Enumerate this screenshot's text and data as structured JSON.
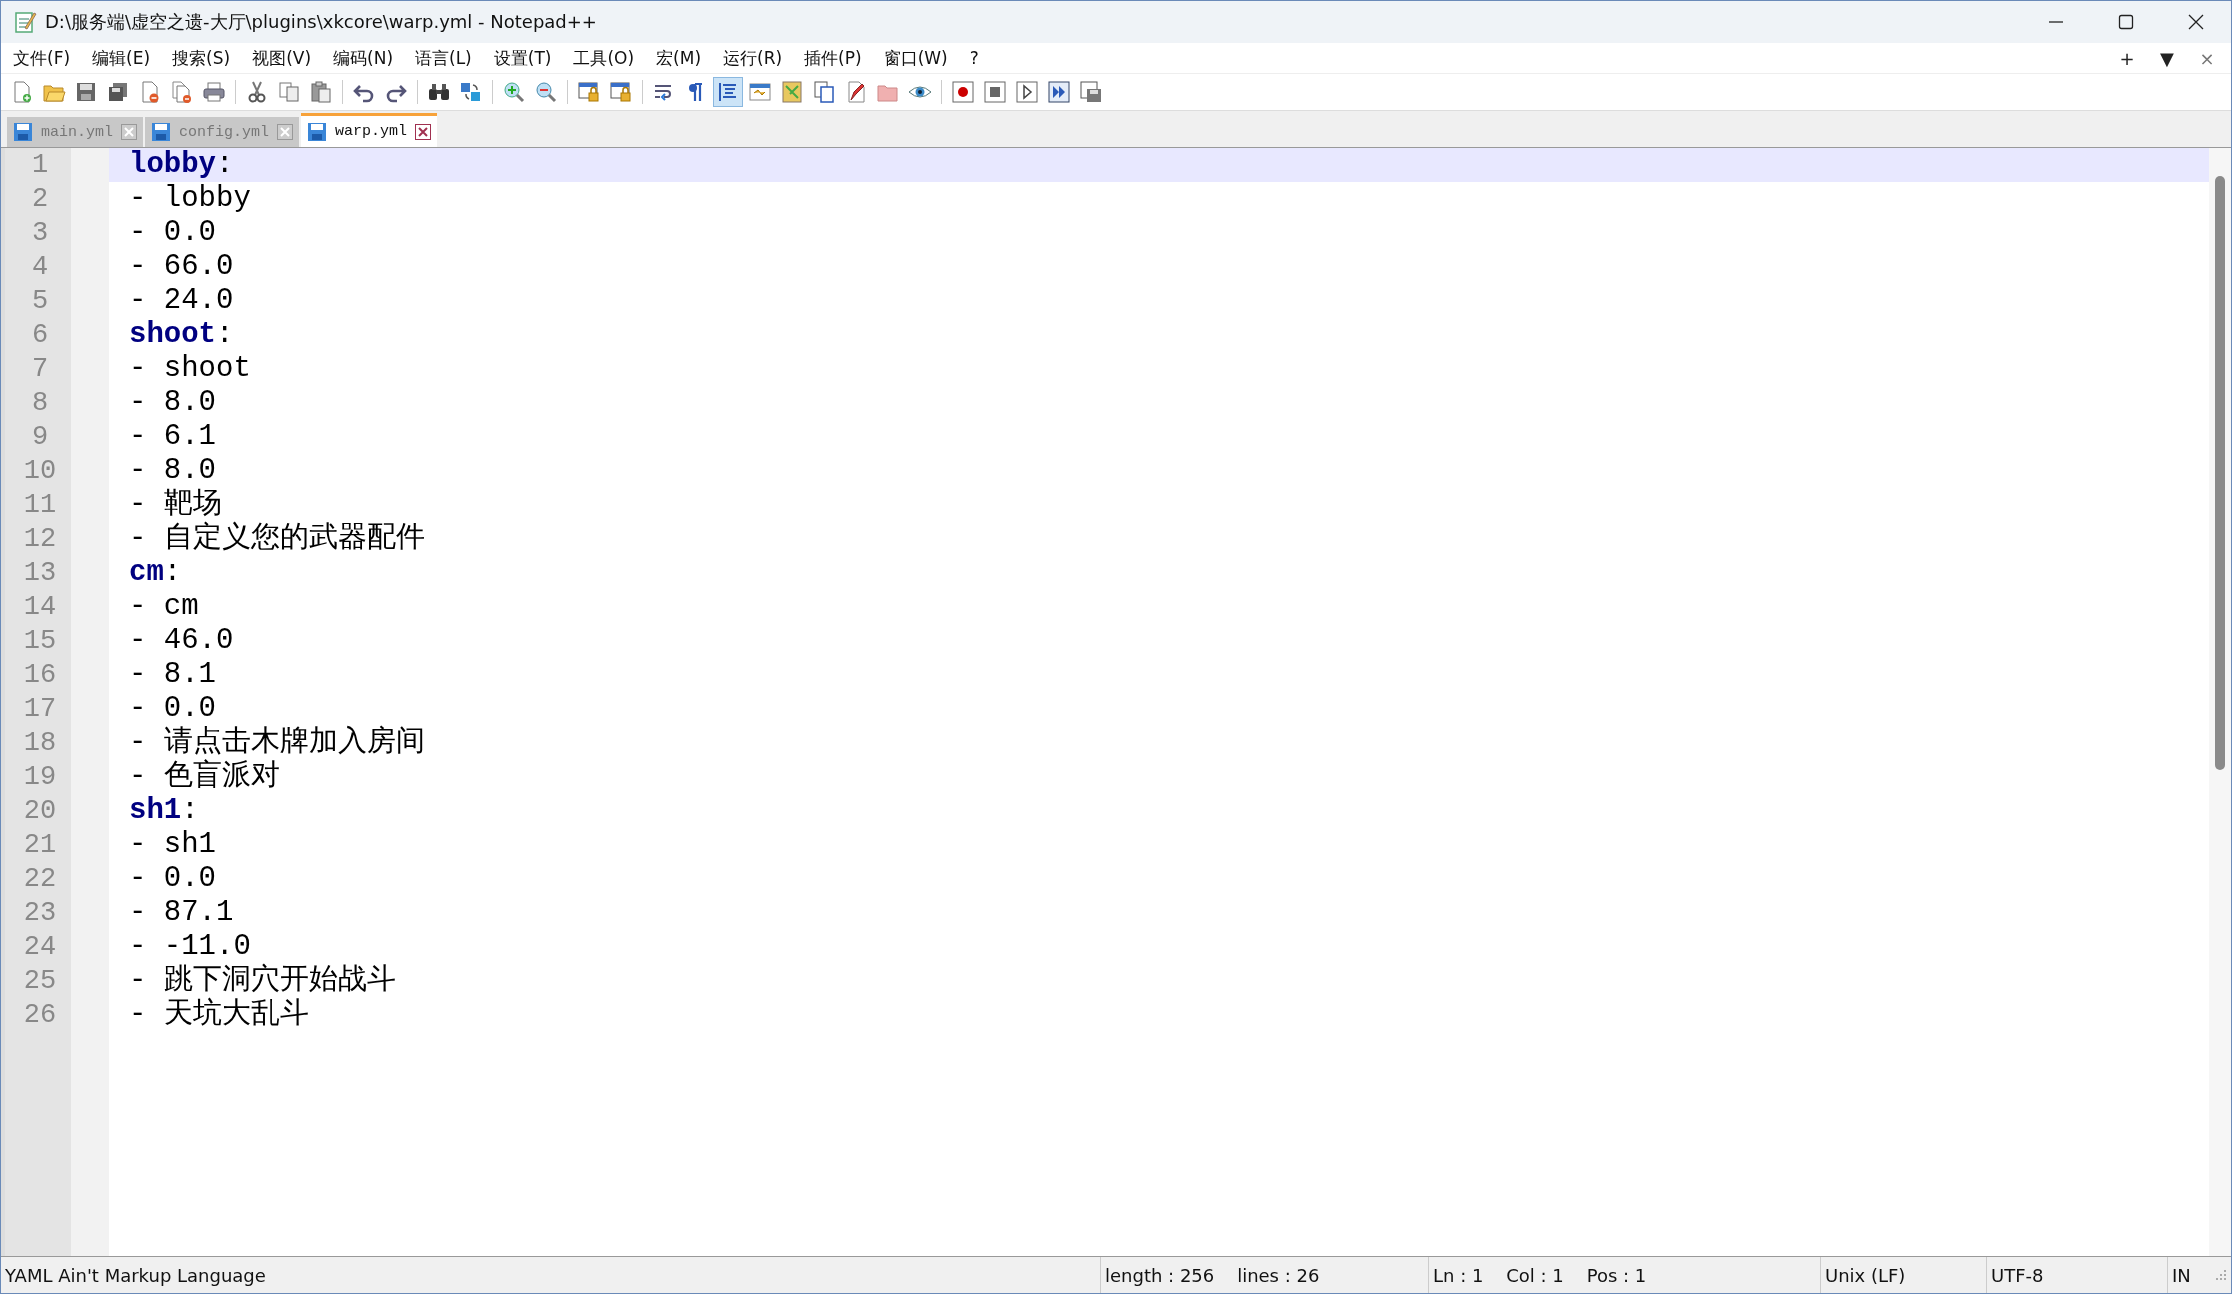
{
  "window": {
    "title": "D:\\服务端\\虚空之遗-大厅\\plugins\\xkcore\\warp.yml - Notepad++"
  },
  "menu": [
    "文件(F)",
    "编辑(E)",
    "搜索(S)",
    "视图(V)",
    "编码(N)",
    "语言(L)",
    "设置(T)",
    "工具(O)",
    "宏(M)",
    "运行(R)",
    "插件(P)",
    "窗口(W)",
    "?"
  ],
  "menu_right": [
    "+",
    "▼",
    "×"
  ],
  "toolbar": [
    [
      {
        "kind": "new",
        "pressed": false
      },
      {
        "kind": "open",
        "pressed": false
      },
      {
        "kind": "save",
        "pressed": false
      },
      {
        "kind": "saveall",
        "pressed": false
      },
      {
        "kind": "close",
        "pressed": false
      },
      {
        "kind": "closeall",
        "pressed": false
      },
      {
        "kind": "print",
        "pressed": false
      }
    ],
    [
      {
        "kind": "cut",
        "pressed": false
      },
      {
        "kind": "copy",
        "pressed": false
      },
      {
        "kind": "paste",
        "pressed": false
      }
    ],
    [
      {
        "kind": "undo",
        "pressed": false
      },
      {
        "kind": "redo",
        "pressed": false
      }
    ],
    [
      {
        "kind": "find",
        "pressed": false
      },
      {
        "kind": "replace",
        "pressed": false
      }
    ],
    [
      {
        "kind": "zoomin",
        "pressed": false
      },
      {
        "kind": "zoomout",
        "pressed": false
      }
    ],
    [
      {
        "kind": "lockwin",
        "pressed": false
      },
      {
        "kind": "lockwin",
        "pressed": false
      }
    ],
    [
      {
        "kind": "wrap",
        "pressed": false
      },
      {
        "kind": "pilcrow",
        "pressed": false
      },
      {
        "kind": "indent",
        "pressed": true
      },
      {
        "kind": "panel",
        "pressed": false
      },
      {
        "kind": "map",
        "pressed": false
      },
      {
        "kind": "pages",
        "pressed": false
      },
      {
        "kind": "pen",
        "pressed": false
      },
      {
        "kind": "folder",
        "pressed": false
      },
      {
        "kind": "eye",
        "pressed": false
      }
    ],
    [
      {
        "kind": "record",
        "pressed": false
      },
      {
        "kind": "stop",
        "pressed": false
      },
      {
        "kind": "play",
        "pressed": false
      },
      {
        "kind": "playmulti",
        "pressed": false
      },
      {
        "kind": "savemacro",
        "pressed": false
      }
    ]
  ],
  "tabs": [
    {
      "label": "main.yml",
      "selected": false
    },
    {
      "label": "config.yml",
      "selected": false
    },
    {
      "label": "warp.yml",
      "selected": true
    }
  ],
  "lines": [
    {
      "number": "1",
      "kind": "key",
      "key": "lobby",
      "sep": ":",
      "current": true
    },
    {
      "number": "2",
      "kind": "item",
      "text": "- lobby",
      "current": false
    },
    {
      "number": "3",
      "kind": "item",
      "text": "- 0.0",
      "current": false
    },
    {
      "number": "4",
      "kind": "item",
      "text": "- 66.0",
      "current": false
    },
    {
      "number": "5",
      "kind": "item",
      "text": "- 24.0",
      "current": false
    },
    {
      "number": "6",
      "kind": "key",
      "key": "shoot",
      "sep": ":",
      "current": false
    },
    {
      "number": "7",
      "kind": "item",
      "text": "- shoot",
      "current": false
    },
    {
      "number": "8",
      "kind": "item",
      "text": "- 8.0",
      "current": false
    },
    {
      "number": "9",
      "kind": "item",
      "text": "- 6.1",
      "current": false
    },
    {
      "number": "10",
      "kind": "item",
      "text": "- 8.0",
      "current": false
    },
    {
      "number": "11",
      "kind": "item",
      "text": "- 靶场",
      "current": false
    },
    {
      "number": "12",
      "kind": "item",
      "text": "- 自定义您的武器配件",
      "current": false
    },
    {
      "number": "13",
      "kind": "key",
      "key": "cm",
      "sep": ":",
      "current": false
    },
    {
      "number": "14",
      "kind": "item",
      "text": "- cm",
      "current": false
    },
    {
      "number": "15",
      "kind": "item",
      "text": "- 46.0",
      "current": false
    },
    {
      "number": "16",
      "kind": "item",
      "text": "- 8.1",
      "current": false
    },
    {
      "number": "17",
      "kind": "item",
      "text": "- 0.0",
      "current": false
    },
    {
      "number": "18",
      "kind": "item",
      "text": "- 请点击木牌加入房间",
      "current": false
    },
    {
      "number": "19",
      "kind": "item",
      "text": "- 色盲派对",
      "current": false
    },
    {
      "number": "20",
      "kind": "key",
      "key": "sh1",
      "sep": ":",
      "current": false
    },
    {
      "number": "21",
      "kind": "item",
      "text": "- sh1",
      "current": false
    },
    {
      "number": "22",
      "kind": "item",
      "text": "- 0.0",
      "current": false
    },
    {
      "number": "23",
      "kind": "item",
      "text": "- 87.1",
      "current": false
    },
    {
      "number": "24",
      "kind": "item",
      "text": "- -11.0",
      "current": false
    },
    {
      "number": "25",
      "kind": "item",
      "text": "- 跳下洞穴开始战斗",
      "current": false
    },
    {
      "number": "26",
      "kind": "item",
      "text": "- 天坑大乱斗",
      "current": false
    }
  ],
  "status_bar": [
    "YAML Ain't Markup Language",
    "length : 256    lines : 26",
    "Ln : 1    Col : 1    Pos : 1",
    "Unix (LF)",
    "UTF-8",
    "IN"
  ]
}
